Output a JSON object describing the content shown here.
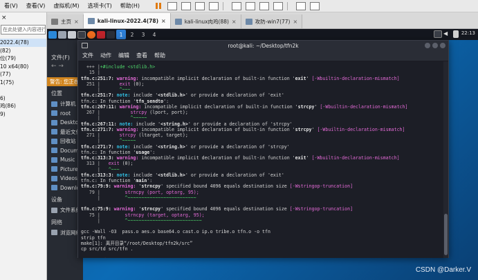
{
  "host": {
    "menu": [
      "看(V)",
      "查看(V)",
      "虚拟机(M)",
      "选项卡(T)",
      "帮助(H)"
    ]
  },
  "library": {
    "search_placeholder": "在此处键入内容进行搜索",
    "vms": [
      "2022.4(78)",
      "(82)",
      "位(79)",
      "10 x64(80)",
      "(77)",
      "1(75)",
      "",
      "6)",
      "鸡(86)",
      "9)"
    ]
  },
  "vm_tabs": [
    {
      "label": "主页",
      "active": false
    },
    {
      "label": "kali-linux-2022.4(78)",
      "active": true
    },
    {
      "label": "kali-linux肉鸡(88)",
      "active": false
    },
    {
      "label": "攻防-win7(77)",
      "active": false
    }
  ],
  "kali_panel": {
    "workspaces": [
      "1",
      "2",
      "3",
      "4"
    ],
    "active_workspace": "1",
    "clock": "22:13"
  },
  "file_manager": {
    "menu": "文件(F)",
    "warning": "警告: 您正在使用 root 账户",
    "section_places": "位置",
    "places": [
      "计算机",
      "root",
      "Desktop",
      "最近文件",
      "回收站",
      "Documents",
      "Music",
      "Pictures",
      "Videos",
      "Downloads"
    ],
    "section_devices": "设备",
    "devices": [
      "文件系统"
    ],
    "section_network": "网络",
    "network": [
      "浏览网络"
    ]
  },
  "terminal": {
    "title": "root@kali: ~/Desktop/tfn2k",
    "menu": [
      "文件",
      "动作",
      "编辑",
      "查看",
      "帮助"
    ],
    "prompt_user": "root㉿kali",
    "prompt_path": "~/Desktop/tfn2k",
    "prompt_symbol": "#",
    "lines": [
      {
        "t": "plain",
        "parts": [
          [
            "ln",
            "  +++ |"
          ],
          [
            "fix",
            "+#include <stdlib.h>"
          ]
        ]
      },
      {
        "t": "plain",
        "parts": [
          [
            "ln",
            "   15 |"
          ]
        ]
      },
      {
        "t": "msg",
        "path": "tfn.c:251:7:",
        "kind": "warning",
        "text": " incompatible implicit declaration of built-in function ",
        "q": "exit",
        "flag": "[-Wbuiltin-declaration-mismatch]"
      },
      {
        "t": "plain",
        "parts": [
          [
            "ln",
            "  251 |       "
          ],
          [
            "hl",
            "exit"
          ],
          [
            "plain",
            " (0);"
          ]
        ]
      },
      {
        "t": "plain",
        "parts": [
          [
            "ln",
            "      |       "
          ],
          [
            "caret",
            "^~~~"
          ]
        ]
      },
      {
        "t": "msg",
        "path": "tfn.c:251:7:",
        "kind": "note",
        "text": " include '",
        "q2": "<stdlib.h>",
        "tail": "' or provide a declaration of 'exit'"
      },
      {
        "t": "plain",
        "parts": [
          [
            "plain",
            "tfn.c: In function '"
          ],
          [
            "bold",
            "tfn_sendto"
          ],
          [
            "plain",
            "':"
          ]
        ]
      },
      {
        "t": "msg",
        "path": "tfn.c:267:11:",
        "kind": "warning",
        "text": " incompatible implicit declaration of built-in function ",
        "q": "strcpy",
        "flag": "[-Wbuiltin-declaration-mismatch]"
      },
      {
        "t": "plain",
        "parts": [
          [
            "ln",
            "  267 |           "
          ],
          [
            "hl",
            "strcpy"
          ],
          [
            "plain",
            " (lport, port);"
          ]
        ]
      },
      {
        "t": "plain",
        "parts": [
          [
            "ln",
            "      |           "
          ],
          [
            "caret",
            "^~~~~~"
          ]
        ]
      },
      {
        "t": "msg",
        "path": "tfn.c:267:11:",
        "kind": "note",
        "text": " include '",
        "q2": "<string.h>",
        "tail": "' or provide a declaration of 'strcpy'"
      },
      {
        "t": "msg",
        "path": "tfn.c:271:7:",
        "kind": "warning",
        "text": " incompatible implicit declaration of built-in function ",
        "q": "strcpy",
        "flag": "[-Wbuiltin-declaration-mismatch]"
      },
      {
        "t": "plain",
        "parts": [
          [
            "ln",
            "  271 |       "
          ],
          [
            "hl",
            "strcpy"
          ],
          [
            "plain",
            " (ltarget, target);"
          ]
        ]
      },
      {
        "t": "plain",
        "parts": [
          [
            "ln",
            "      |       "
          ],
          [
            "caret",
            "^~~~~~"
          ]
        ]
      },
      {
        "t": "msg",
        "path": "tfn.c:271:7:",
        "kind": "note",
        "text": " include '",
        "q2": "<string.h>",
        "tail": "' or provide a declaration of 'strcpy'"
      },
      {
        "t": "plain",
        "parts": [
          [
            "plain",
            "tfn.c: In function '"
          ],
          [
            "bold",
            "usage"
          ],
          [
            "plain",
            "':"
          ]
        ]
      },
      {
        "t": "msg",
        "path": "tfn.c:313:3:",
        "kind": "warning",
        "text": " incompatible implicit declaration of built-in function ",
        "q": "exit",
        "flag": "[-Wbuiltin-declaration-mismatch]"
      },
      {
        "t": "plain",
        "parts": [
          [
            "ln",
            "  313 |   "
          ],
          [
            "hl",
            "exit"
          ],
          [
            "plain",
            " (0);"
          ]
        ]
      },
      {
        "t": "plain",
        "parts": [
          [
            "ln",
            "      |   "
          ],
          [
            "caret",
            "^~~~"
          ]
        ]
      },
      {
        "t": "msg",
        "path": "tfn.c:313:3:",
        "kind": "note",
        "text": " include '",
        "q2": "<stdlib.h>",
        "tail": "' or provide a declaration of 'exit'"
      },
      {
        "t": "plain",
        "parts": [
          [
            "plain",
            "tfn.c: In function '"
          ],
          [
            "bold",
            "main"
          ],
          [
            "plain",
            "':"
          ]
        ]
      },
      {
        "t": "msg",
        "path": "tfn.c:79:9:",
        "kind": "warning",
        "text": " '",
        "q2": "strncpy",
        "tail": "' specified bound 4096 equals destination size ",
        "flag": "[-Wstringop-truncation]"
      },
      {
        "t": "plain",
        "parts": [
          [
            "ln",
            "   79 |         "
          ],
          [
            "hl",
            "strncpy (port, optarg, 95);"
          ]
        ]
      },
      {
        "t": "plain",
        "parts": [
          [
            "ln",
            "      |         "
          ],
          [
            "caret",
            "^~~~~~~~~~~~~~~~~~~~~~~~~~"
          ]
        ]
      },
      {
        "t": "plain",
        "parts": [
          [
            "plain",
            " "
          ]
        ]
      },
      {
        "t": "msg",
        "path": "tfn.c:75:9:",
        "kind": "warning",
        "text": " '",
        "q2": "strncpy",
        "tail": "' specified bound 4096 equals destination size ",
        "flag": "[-Wstringop-truncation]"
      },
      {
        "t": "plain",
        "parts": [
          [
            "ln",
            "   75 |         "
          ],
          [
            "hl",
            "strncpy (target, optarg, 95);"
          ]
        ]
      },
      {
        "t": "plain",
        "parts": [
          [
            "ln",
            "      |         "
          ],
          [
            "caret",
            "^~~~~~~~~~~~~~~~~~~~~~~~~~~~"
          ]
        ]
      },
      {
        "t": "plain",
        "parts": [
          [
            "plain",
            " "
          ]
        ]
      },
      {
        "t": "plain",
        "parts": [
          [
            "plain",
            "gcc -Wall -O3  pass.o aes.o base64.o cast.o ip.o tribe.o tfn.o -o tfn"
          ]
        ]
      },
      {
        "t": "plain",
        "parts": [
          [
            "plain",
            "strip tfn"
          ]
        ]
      },
      {
        "t": "plain",
        "parts": [
          [
            "plain",
            "make[1]: 离开目录“/root/Desktop/tfn2k/src”"
          ]
        ]
      },
      {
        "t": "plain",
        "parts": [
          [
            "plain",
            "cp src/td src/tfn ."
          ]
        ]
      },
      {
        "t": "plain",
        "parts": [
          [
            "plain",
            " "
          ]
        ]
      }
    ]
  },
  "watermark": "CSDN @Darker.V"
}
